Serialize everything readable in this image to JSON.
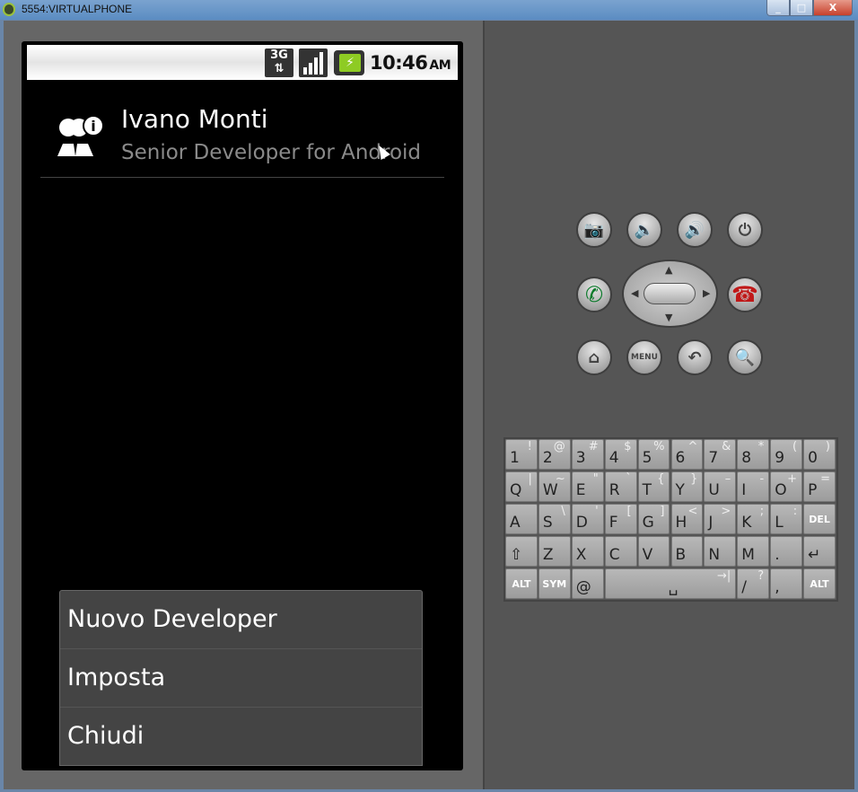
{
  "window": {
    "title": "5554:VIRTUALPHONE",
    "min": "_",
    "max": "□",
    "close": "X"
  },
  "status_bar": {
    "network": "3G",
    "network_arrows": "⇅",
    "battery": "⚡",
    "time": "10:46",
    "ampm": "AM"
  },
  "profile": {
    "name": "Ivano Monti",
    "role": "Senior Developer for Android"
  },
  "menu": {
    "items": [
      "Nuovo Developer",
      "Imposta",
      "Chiudi"
    ]
  },
  "controls": {
    "menu_label": "MENU"
  },
  "keyboard": {
    "rows": [
      [
        [
          "1",
          "!"
        ],
        [
          "2",
          "@"
        ],
        [
          "3",
          "#"
        ],
        [
          "4",
          "$"
        ],
        [
          "5",
          "%"
        ],
        [
          "6",
          "^"
        ],
        [
          "7",
          "&"
        ],
        [
          "8",
          "*"
        ],
        [
          "9",
          "("
        ],
        [
          "0",
          ")"
        ]
      ],
      [
        [
          "Q",
          "|"
        ],
        [
          "W",
          "~"
        ],
        [
          "E",
          "\""
        ],
        [
          "R",
          "`"
        ],
        [
          "T",
          "{"
        ],
        [
          "Y",
          "}"
        ],
        [
          "U",
          "–"
        ],
        [
          "I",
          "-"
        ],
        [
          "O",
          "+"
        ],
        [
          "P",
          "="
        ]
      ],
      [
        [
          "A",
          ""
        ],
        [
          "S",
          "\\"
        ],
        [
          "D",
          "'"
        ],
        [
          "F",
          "["
        ],
        [
          "G",
          "]"
        ],
        [
          "H",
          "<"
        ],
        [
          "J",
          ">"
        ],
        [
          "K",
          ";"
        ],
        [
          "L",
          ":"
        ],
        [
          "DEL",
          ""
        ]
      ],
      [
        [
          "⇧",
          ""
        ],
        [
          "Z",
          ""
        ],
        [
          "X",
          ""
        ],
        [
          "C",
          ""
        ],
        [
          "V",
          ""
        ],
        [
          "B",
          ""
        ],
        [
          "N",
          ""
        ],
        [
          "M",
          ""
        ],
        [
          ".",
          ""
        ],
        [
          "↵",
          ""
        ]
      ],
      [
        [
          "ALT",
          ""
        ],
        [
          "SYM",
          ""
        ],
        [
          "@",
          ""
        ],
        [
          "␣",
          "→|"
        ],
        [
          "/",
          "?"
        ],
        [
          ",",
          ""
        ],
        [
          "ALT",
          ""
        ]
      ]
    ]
  }
}
